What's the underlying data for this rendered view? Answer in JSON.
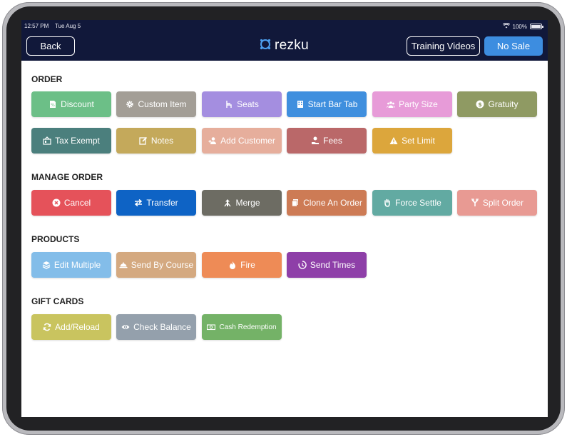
{
  "status_bar": {
    "time": "12:57 PM",
    "date": "Tue Aug 5",
    "battery": "100%"
  },
  "header": {
    "back_label": "Back",
    "brand": "rezku",
    "training_label": "Training Videos",
    "no_sale_label": "No Sale"
  },
  "sections": {
    "order": {
      "title": "ORDER",
      "buttons": [
        {
          "label": "Discount",
          "color": "#6cbf87",
          "icon": "discount-tag-icon"
        },
        {
          "label": "Custom Item",
          "color": "#a39e96",
          "icon": "gear-icon"
        },
        {
          "label": "Seats",
          "color": "#a48ee0",
          "icon": "chair-icon"
        },
        {
          "label": "Start Bar Tab",
          "color": "#3f8fde",
          "icon": "building-icon"
        },
        {
          "label": "Party Size",
          "color": "#e79bd8",
          "icon": "group-icon"
        },
        {
          "label": "Gratuity",
          "color": "#8f9a63",
          "icon": "dollar-circle-icon"
        },
        {
          "label": "Tax Exempt",
          "color": "#4b7f7d",
          "icon": "tax-exempt-icon"
        },
        {
          "label": "Notes",
          "color": "#c4a95b",
          "icon": "edit-note-icon"
        },
        {
          "label": "Add Customer",
          "color": "#e6ae9c",
          "icon": "add-user-icon"
        },
        {
          "label": "Fees",
          "color": "#ba6869",
          "icon": "hand-money-icon"
        },
        {
          "label": "Set Limit",
          "color": "#dca63c",
          "icon": "warning-icon"
        }
      ]
    },
    "manage_order": {
      "title": "MANAGE ORDER",
      "buttons": [
        {
          "label": "Cancel",
          "color": "#e5525a",
          "icon": "close-circle-icon"
        },
        {
          "label": "Transfer",
          "color": "#0e63c5",
          "icon": "transfer-arrows-icon"
        },
        {
          "label": "Merge",
          "color": "#6d6c63",
          "icon": "merge-icon"
        },
        {
          "label": "Clone An Order",
          "color": "#cd7b55",
          "icon": "copy-icon"
        },
        {
          "label": "Force Settle",
          "color": "#62aaa2",
          "icon": "hand-icon"
        },
        {
          "label": "Split Order",
          "color": "#e89a93",
          "icon": "split-icon"
        }
      ]
    },
    "products": {
      "title": "PRODUCTS",
      "buttons": [
        {
          "label": "Edit Multiple",
          "color": "#83bde9",
          "icon": "layers-icon"
        },
        {
          "label": "Send By Course",
          "color": "#d4a980",
          "icon": "cloche-icon"
        },
        {
          "label": "Fire",
          "color": "#ee8b56",
          "icon": "fire-icon"
        },
        {
          "label": "Send Times",
          "color": "#8e3fa8",
          "icon": "timer-icon"
        }
      ]
    },
    "gift_cards": {
      "title": "GIFT CARDS",
      "buttons": [
        {
          "label": "Add/Reload",
          "color": "#c9c45f",
          "icon": "reload-icon"
        },
        {
          "label": "Check Balance",
          "color": "#94a0ac",
          "icon": "eye-icon"
        },
        {
          "label": "Cash Redemption",
          "color": "#74b267",
          "icon": "cash-icon"
        }
      ]
    }
  }
}
